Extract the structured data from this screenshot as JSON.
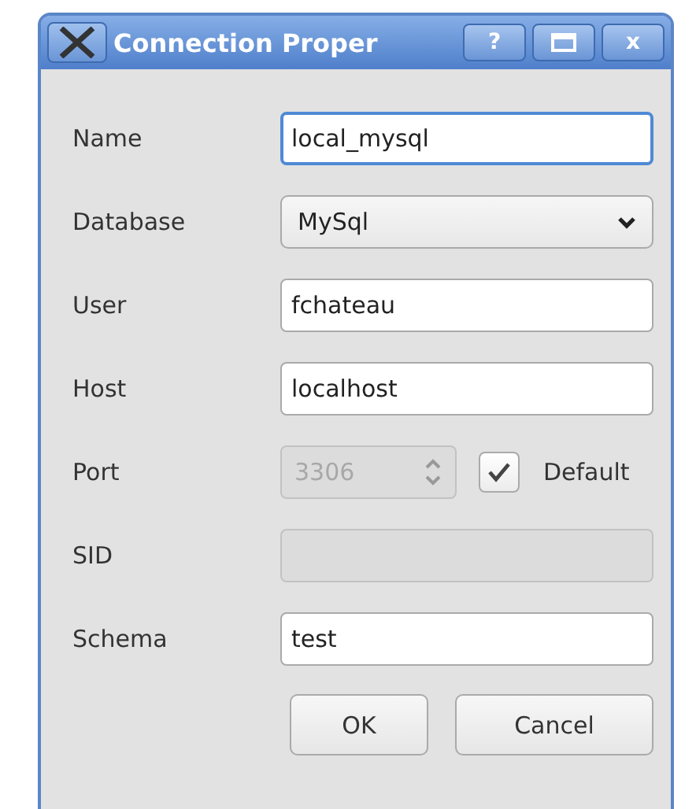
{
  "window": {
    "title": "Connection Proper",
    "help_button": "?",
    "close_button": "x"
  },
  "fields": [
    {
      "label": "Name",
      "kind": "text",
      "value": "local_mysql",
      "focused": true,
      "disabled": false
    },
    {
      "label": "Database",
      "kind": "select",
      "value": "MySql",
      "focused": false,
      "disabled": false
    },
    {
      "label": "User",
      "kind": "text",
      "value": "fchateau",
      "focused": false,
      "disabled": false
    },
    {
      "label": "Host",
      "kind": "text",
      "value": "localhost",
      "focused": false,
      "disabled": false
    },
    {
      "label": "Port",
      "kind": "spin",
      "value": "3306",
      "focused": false,
      "disabled": true,
      "checkbox": {
        "label": "Default",
        "checked": true
      }
    },
    {
      "label": "SID",
      "kind": "text",
      "focused": false,
      "disabled": true
    },
    {
      "label": "Schema",
      "kind": "text",
      "value": "test",
      "focused": false,
      "disabled": false
    }
  ],
  "buttons": [
    "OK",
    "Cancel"
  ]
}
